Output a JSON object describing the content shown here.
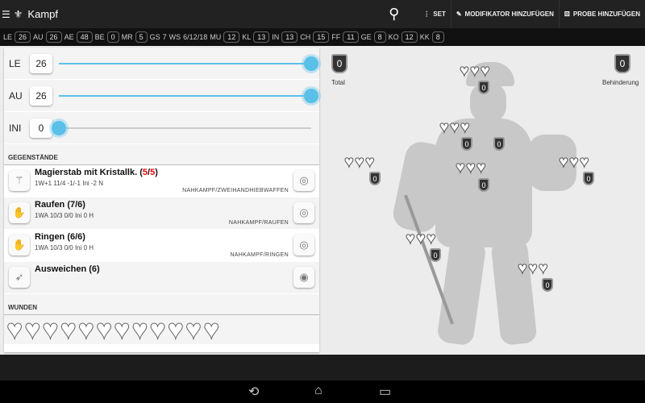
{
  "header": {
    "title": "Kampf",
    "actions": [
      "SET",
      "MODIFIKATOR HINZUFÜGEN",
      "PROBE HINZUFÜGEN"
    ]
  },
  "stats": [
    [
      "LE",
      "26"
    ],
    [
      "AU",
      "26"
    ],
    [
      "AE",
      "48"
    ],
    [
      "BE",
      "0"
    ],
    [
      "MR",
      "5"
    ],
    [
      "GS",
      "7",
      false
    ],
    [
      "WS",
      "6/12/18",
      false
    ],
    [
      "MU",
      "12"
    ],
    [
      "KL",
      "13"
    ],
    [
      "IN",
      "13"
    ],
    [
      "CH",
      "15"
    ],
    [
      "FF",
      "11"
    ],
    [
      "GE",
      "8"
    ],
    [
      "KO",
      "12"
    ],
    [
      "KK",
      "8"
    ]
  ],
  "sliders": [
    {
      "label": "LE",
      "value": "26",
      "fraction": 1.0
    },
    {
      "label": "AU",
      "value": "26",
      "fraction": 1.0
    },
    {
      "label": "INI",
      "value": "0",
      "fraction": 0.0
    }
  ],
  "items_title": "GEGENSTÄNDE",
  "items": [
    {
      "name": "Magierstab mit Kristallk. (",
      "a": "5",
      "sep": "/",
      "b": "5",
      "close": ")",
      "desc": "1W+1 11/4 -1/-1 Ini -2 N",
      "cat": "NAHKAMPF/ZWEIHANDHIEBWAFFEN",
      "icon": "staff-icon",
      "action": "shield-icon"
    },
    {
      "name": "Raufen (7/6)",
      "desc": "1WA 10/3 0/0 Ini 0 H",
      "cat": "NAHKAMPF/RAUFEN",
      "icon": "hand-icon",
      "action": "shield-icon"
    },
    {
      "name": "Ringen (6/6)",
      "desc": "1WA 10/3 0/0 Ini 0 H",
      "cat": "NAHKAMPF/RINGEN",
      "icon": "hand-icon",
      "action": "shield-icon"
    },
    {
      "name": "Ausweichen (6)",
      "desc": "",
      "cat": "",
      "icon": "dodge-icon",
      "action": "target-icon"
    }
  ],
  "wounds_title": "WUNDEN",
  "wound_count": 12,
  "body": {
    "total_label": "Total",
    "total": "0",
    "encumbrance_label": "Behinderung",
    "encumbrance": "0",
    "zone_armor": "0"
  }
}
